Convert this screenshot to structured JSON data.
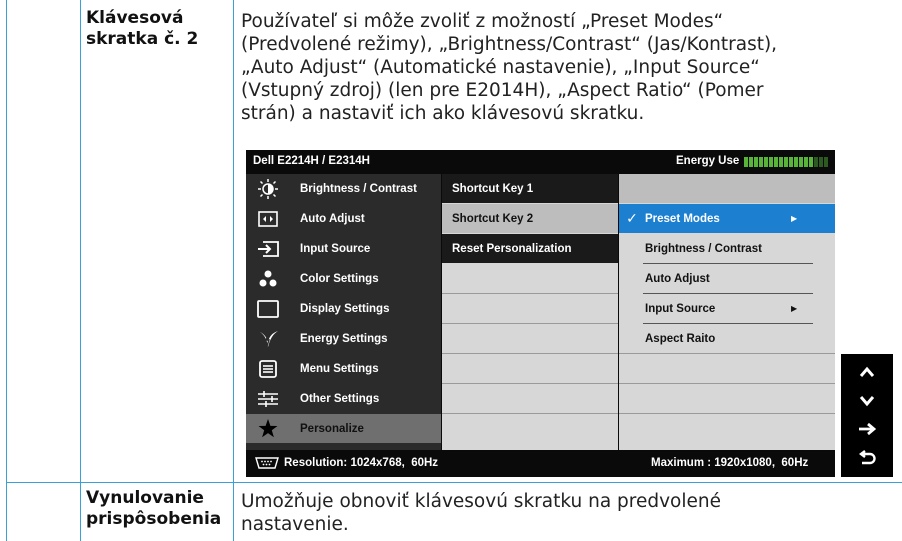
{
  "row1": {
    "term_line1": "Klávesová",
    "term_line2": "skratka č. 2",
    "desc_lines": [
      "Používateľ si môže zvoliť z možností „Preset Modes“",
      "(Predvolené režimy), „Brightness/Contrast“ (Jas/Kontrast),",
      "„Auto Adjust“ (Automatické nastavenie), „Input Source“",
      "(Vstupný zdroj) (len pre E2014H), „Aspect Ratio“ (Pomer",
      "strán) a nastaviť ich ako klávesovú skratku."
    ]
  },
  "row2": {
    "term_line1": "Vynulovanie",
    "term_line2": "prispôsobenia",
    "desc_lines": [
      "Umožňuje obnoviť klávesovú skratku na predvolené",
      "nastavenie."
    ]
  },
  "osd": {
    "title": "Dell E2214H / E2314H",
    "energy_label": "Energy Use",
    "energy_level": 0.82,
    "menu": [
      {
        "label": "Brightness / Contrast",
        "icon": "brightness-icon"
      },
      {
        "label": "Auto Adjust",
        "icon": "auto-adjust-icon"
      },
      {
        "label": "Input Source",
        "icon": "input-source-icon"
      },
      {
        "label": "Color Settings",
        "icon": "color-settings-icon"
      },
      {
        "label": "Display Settings",
        "icon": "display-settings-icon"
      },
      {
        "label": "Energy Settings",
        "icon": "energy-settings-icon"
      },
      {
        "label": "Menu Settings",
        "icon": "menu-settings-icon"
      },
      {
        "label": "Other Settings",
        "icon": "other-settings-icon"
      },
      {
        "label": "Personalize",
        "icon": "star-icon",
        "active": true
      }
    ],
    "submenu": [
      "Shortcut Key 1",
      "Shortcut Key 2",
      "Reset Personalization"
    ],
    "options": [
      {
        "label": "Preset Modes",
        "selected": true,
        "has_arrow": true
      },
      {
        "label": "Brightness / Contrast"
      },
      {
        "label": "Auto Adjust"
      },
      {
        "label": "Input Source",
        "has_arrow": true
      },
      {
        "label": "Aspect Raito"
      }
    ],
    "resolution": "Resolution: 1024x768,  60Hz",
    "maximum": "Maximum : 1920x1080,  60Hz",
    "nav_buttons": [
      "up-icon",
      "down-icon",
      "enter-icon",
      "back-icon"
    ],
    "colors": {
      "selected": "#1c7fd0",
      "energy": "#59b53a",
      "table_border": "#3aa0d6"
    }
  }
}
